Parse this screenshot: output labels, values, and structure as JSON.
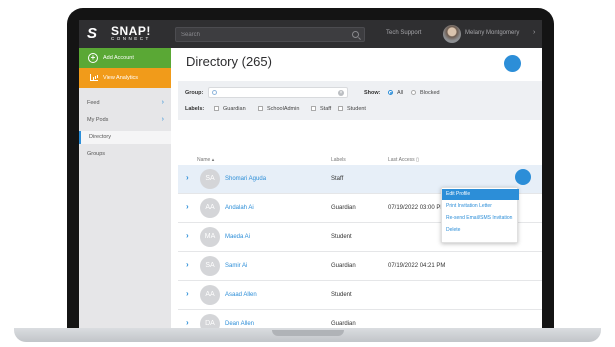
{
  "colors": {
    "accent": "#2c8ed8",
    "add_green": "#5aa835",
    "analytics_orange": "#f19b1a",
    "topbar": "#2f2f31"
  },
  "topbar": {
    "logo_mark": "S",
    "logo_text": "SNAP!",
    "logo_sub": "CONNECT",
    "search_placeholder": "Search",
    "tech_support": "Tech Support",
    "user_name": "Melany Montgomery",
    "user_chevron": "›"
  },
  "sidebar": {
    "add_account": "Add Account",
    "view_analytics": "View Analytics",
    "items": [
      {
        "label": "Feed",
        "chevron": "›"
      },
      {
        "label": "My Pods",
        "chevron": "›"
      },
      {
        "label": "Directory",
        "chevron": ""
      },
      {
        "label": "Groups",
        "chevron": ""
      }
    ]
  },
  "main": {
    "title": "Directory (265)",
    "filters": {
      "group_label": "Group:",
      "show_label": "Show:",
      "show_options": [
        "All",
        "Blocked"
      ],
      "labels_label": "Labels:",
      "label_options": [
        "Guardian",
        "SchoolAdmin",
        "Staff",
        "Student"
      ]
    },
    "columns": {
      "name": "Name ▴",
      "labels": "Labels",
      "last_access": "Last Access ▯"
    },
    "rows": [
      {
        "initials": "SA",
        "name": "Shomari Aguda",
        "label": "Staff",
        "last_access": ""
      },
      {
        "initials": "AA",
        "name": "Andalah Ai",
        "label": "Guardian",
        "last_access": "07/19/2022 03:00 PM"
      },
      {
        "initials": "MA",
        "name": "Maeda Ai",
        "label": "Student",
        "last_access": ""
      },
      {
        "initials": "SA",
        "name": "Samir Ai",
        "label": "Guardian",
        "last_access": "07/19/2022 04:21 PM"
      },
      {
        "initials": "AA",
        "name": "Asaad Allen",
        "label": "Student",
        "last_access": ""
      },
      {
        "initials": "DA",
        "name": "Dean Allen",
        "label": "Guardian",
        "last_access": ""
      }
    ],
    "row_chevron": "›",
    "context_menu": [
      "Edit Profile",
      "Print Invitation Letter",
      "Re-send Email/SMS Invitation",
      "Delete"
    ]
  }
}
